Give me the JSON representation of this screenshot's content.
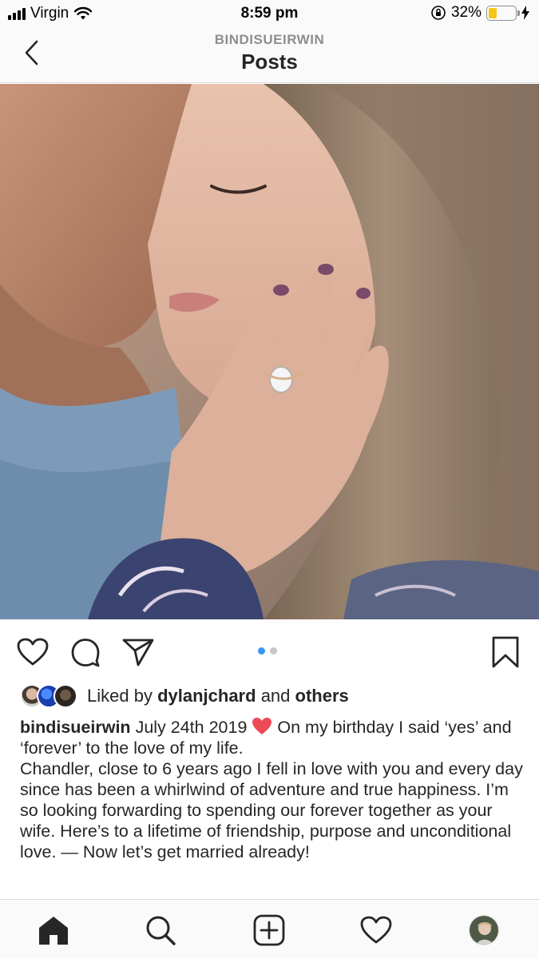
{
  "status_bar": {
    "carrier": "Virgin",
    "time": "8:59 pm",
    "battery_percent": "32%",
    "battery_level": 0.32,
    "icons": [
      "signal-bars-icon",
      "wifi-icon",
      "orientation-lock-icon",
      "battery-icon",
      "charging-bolt-icon"
    ]
  },
  "header": {
    "username": "BINDISUEIRWIN",
    "title": "Posts",
    "back_icon": "chevron-left-icon"
  },
  "post": {
    "image_alt": "Engagement photo of a couple, woman showing an oval diamond ring",
    "actions": [
      "heart-icon",
      "comment-icon",
      "share-icon",
      "bookmark-icon"
    ],
    "carousel": {
      "count": 2,
      "active": 1
    },
    "likes": {
      "prefix": "Liked by",
      "user": "dylanjchard",
      "joiner": "and",
      "others": "others"
    },
    "caption": {
      "username": "bindisueirwin",
      "line1_date": "July 24th 2019",
      "line1_rest": "On my birthday I said ‘yes’ and ‘forever’ to the love of my life.",
      "body": "Chandler, close to 6 years ago I fell in love with you and every day since has been a whirlwind of adventure and true happiness. I’m so looking forwarding to spending our forever together as your wife. Here’s to a lifetime of friendship, purpose and unconditional love. — Now let’s get married already!",
      "emoji": "red-heart-icon"
    }
  },
  "tab_bar": {
    "items": [
      "home-icon",
      "search-icon",
      "new-post-icon",
      "activity-heart-icon",
      "profile-avatar"
    ]
  },
  "colors": {
    "accent": "#3897f0",
    "text": "#262626",
    "muted": "#8e8e8e",
    "heart": "#ed4956",
    "battery": "#f5c518"
  }
}
